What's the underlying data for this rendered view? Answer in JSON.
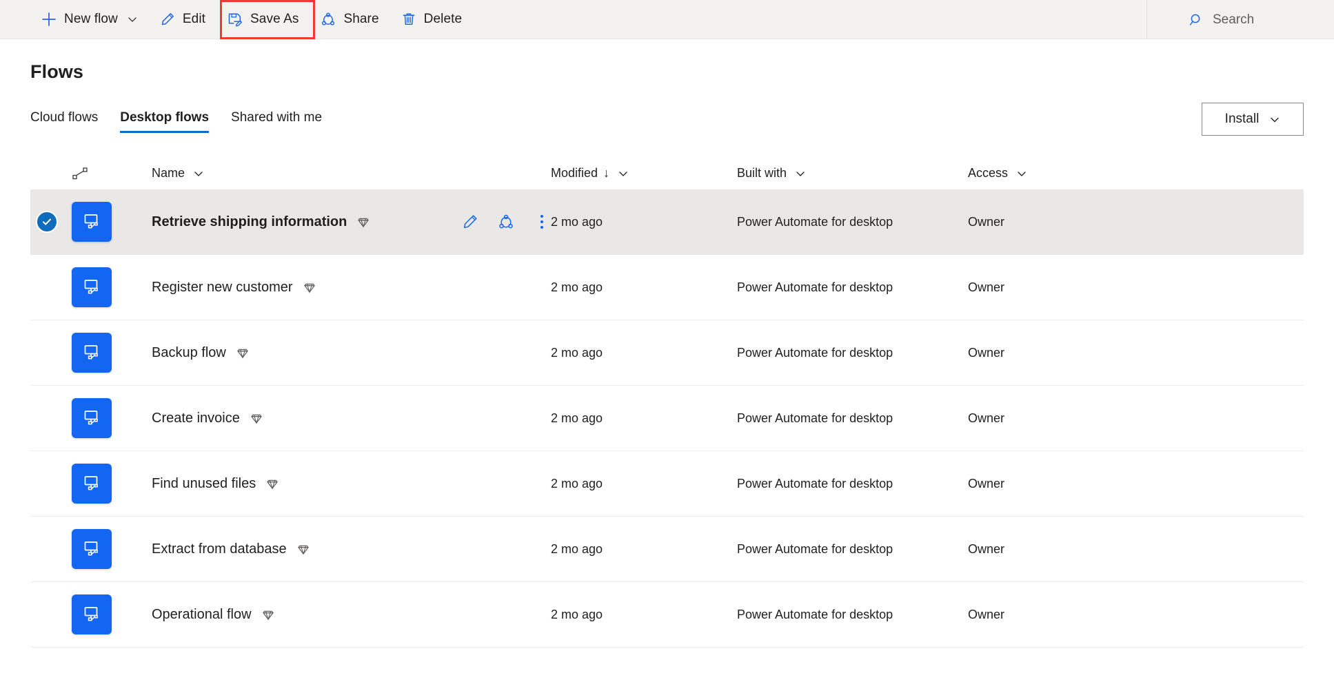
{
  "commandbar": {
    "items": [
      {
        "id": "new-flow",
        "label": "New flow",
        "icon": "plus-icon",
        "has_chevron": true
      },
      {
        "id": "edit",
        "label": "Edit",
        "icon": "pencil-icon",
        "has_chevron": false
      },
      {
        "id": "save-as",
        "label": "Save As",
        "icon": "save-as-icon",
        "has_chevron": false
      },
      {
        "id": "share",
        "label": "Share",
        "icon": "share-icon",
        "has_chevron": false
      },
      {
        "id": "delete",
        "label": "Delete",
        "icon": "trash-icon",
        "has_chevron": false
      }
    ],
    "search": {
      "icon": "search-icon",
      "placeholder": "Search"
    },
    "highlight": {
      "target": "save-as",
      "color": "#f03a2f"
    }
  },
  "header": {
    "title": "Flows",
    "install": {
      "label": "Install",
      "icon": "chevron-down-icon"
    }
  },
  "tabs": [
    {
      "id": "cloud-flows",
      "label": "Cloud flows",
      "active": false
    },
    {
      "id": "desktop-flows",
      "label": "Desktop flows",
      "active": true
    },
    {
      "id": "shared-with-me",
      "label": "Shared with me",
      "active": false
    }
  ],
  "table": {
    "columns": {
      "flow_type_icon": "flow-type-icon",
      "name": "Name",
      "modified": "Modified",
      "modified_sort": "↓",
      "built_with": "Built with",
      "access": "Access"
    },
    "row_actions": [
      {
        "id": "edit",
        "icon": "pencil-icon"
      },
      {
        "id": "share",
        "icon": "share-icon"
      },
      {
        "id": "more",
        "icon": "more-vertical-icon"
      }
    ],
    "rows": [
      {
        "name": "Retrieve shipping information",
        "premium": true,
        "modified": "2 mo ago",
        "built_with": "Power Automate for desktop",
        "access": "Owner",
        "selected": true
      },
      {
        "name": "Register new customer",
        "premium": true,
        "modified": "2 mo ago",
        "built_with": "Power Automate for desktop",
        "access": "Owner",
        "selected": false
      },
      {
        "name": "Backup flow",
        "premium": true,
        "modified": "2 mo ago",
        "built_with": "Power Automate for desktop",
        "access": "Owner",
        "selected": false
      },
      {
        "name": "Create invoice",
        "premium": true,
        "modified": "2 mo ago",
        "built_with": "Power Automate for desktop",
        "access": "Owner",
        "selected": false
      },
      {
        "name": "Find unused files",
        "premium": true,
        "modified": "2 mo ago",
        "built_with": "Power Automate for desktop",
        "access": "Owner",
        "selected": false
      },
      {
        "name": "Extract from database",
        "premium": true,
        "modified": "2 mo ago",
        "built_with": "Power Automate for desktop",
        "access": "Owner",
        "selected": false
      },
      {
        "name": "Operational flow",
        "premium": true,
        "modified": "2 mo ago",
        "built_with": "Power Automate for desktop",
        "access": "Owner",
        "selected": false
      }
    ]
  },
  "colors": {
    "accent": "#0f6cbd",
    "icon_blue": "#1266f1",
    "app_tile": "#1266f1",
    "highlight_red": "#f03a2f",
    "selected_row": "#e9e8e7",
    "commandbar_bg": "#f3f2f1"
  }
}
